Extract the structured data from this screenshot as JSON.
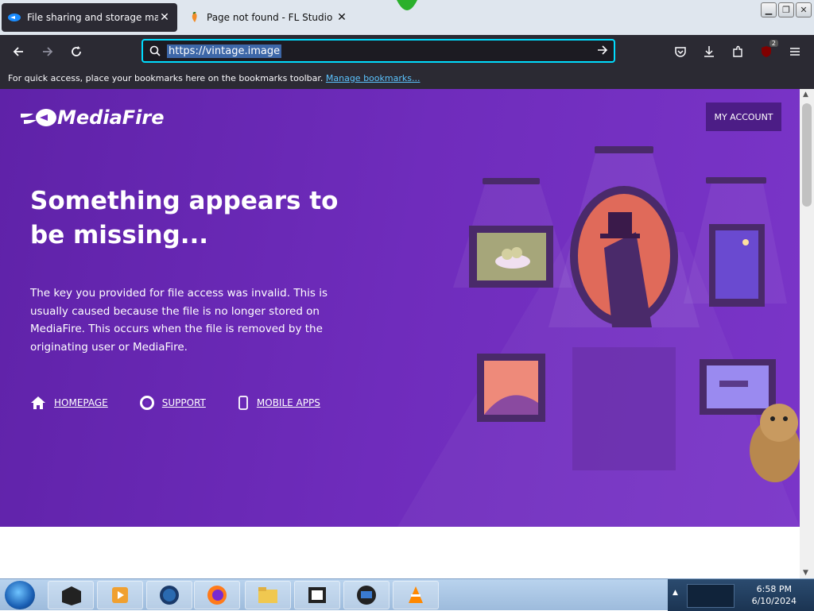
{
  "browser": {
    "tabs": [
      {
        "title": "File sharing and storage made s"
      },
      {
        "title": "Page not found - FL Studio"
      }
    ],
    "url": "https://vintage.image",
    "bookmarks_prompt": "For quick access, place your bookmarks here on the bookmarks toolbar.",
    "bookmarks_link": "Manage bookmarks...",
    "extension_badge": "2"
  },
  "page": {
    "logo_text": "MediaFire",
    "my_account": "MY ACCOUNT",
    "headline": "Something appears to be missing...",
    "description": "The key you provided for file access was invalid. This is usually caused because the file is no longer stored on MediaFire. This occurs when the file is removed by the originating user or MediaFire.",
    "links": [
      {
        "label": "HOMEPAGE",
        "icon": "home-icon"
      },
      {
        "label": "SUPPORT",
        "icon": "lifebuoy-icon"
      },
      {
        "label": "MOBILE APPS",
        "icon": "phone-icon"
      }
    ]
  },
  "taskbar": {
    "time": "6:58 PM",
    "date": "6/10/2024"
  },
  "colors": {
    "accent": "#00ddff",
    "page_purple": "#6f2cbc"
  }
}
